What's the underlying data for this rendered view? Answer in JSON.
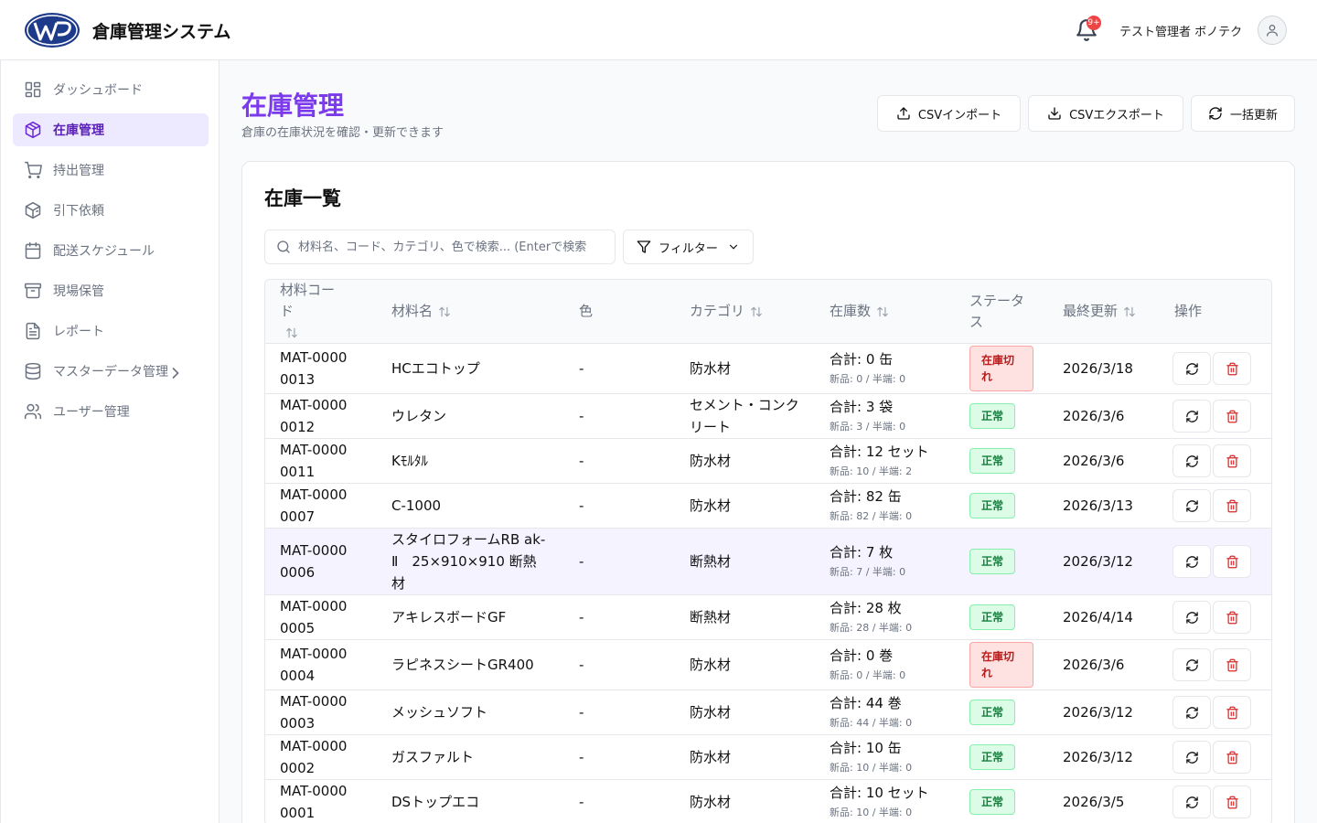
{
  "header": {
    "app_title": "倉庫管理システム",
    "notification_badge": "9+",
    "user_name": "テスト管理者 ボノテク"
  },
  "sidebar": {
    "items": [
      {
        "label": "ダッシュボード",
        "icon": "dashboard-icon"
      },
      {
        "label": "在庫管理",
        "icon": "box-icon",
        "active": true
      },
      {
        "label": "持出管理",
        "icon": "cart-icon"
      },
      {
        "label": "引下依頼",
        "icon": "package-icon"
      },
      {
        "label": "配送スケジュール",
        "icon": "calendar-icon"
      },
      {
        "label": "現場保管",
        "icon": "archive-icon"
      },
      {
        "label": "レポート",
        "icon": "document-icon"
      },
      {
        "label": "マスターデータ管理",
        "icon": "database-icon"
      },
      {
        "label": "ユーザー管理",
        "icon": "users-icon"
      }
    ]
  },
  "page": {
    "title": "在庫管理",
    "subtitle": "倉庫の在庫状況を確認・更新できます",
    "csv_import": "CSVインポート",
    "csv_export": "CSVエクスポート",
    "bulk_update": "一括更新"
  },
  "card": {
    "title": "在庫一覧",
    "search_placeholder": "材料名、コード、カテゴリ、色で検索... (Enterで検索",
    "filter_label": "フィルター"
  },
  "table": {
    "columns": [
      "材料コード",
      "材料名",
      "色",
      "カテゴリ",
      "在庫数",
      "ステータス",
      "最終更新",
      "操作"
    ],
    "rows": [
      {
        "code": "MAT-00000013",
        "name": "HCエコトップ",
        "color": "-",
        "category": "防水材",
        "total": "合計: 0 缶",
        "sub": "新品: 0 / 半端: 0",
        "status": "在庫切れ",
        "status_type": "out",
        "updated": "2026/3/18"
      },
      {
        "code": "MAT-00000012",
        "name": "ウレタン",
        "color": "-",
        "category": "セメント・コンクリート",
        "total": "合計: 3 袋",
        "sub": "新品: 3 / 半端: 0",
        "status": "正常",
        "status_type": "ok",
        "updated": "2026/3/6"
      },
      {
        "code": "MAT-00000011",
        "name": "Kﾓﾙﾀﾙ",
        "color": "-",
        "category": "防水材",
        "total": "合計: 12 セット",
        "sub": "新品: 10 / 半端: 2",
        "status": "正常",
        "status_type": "ok",
        "updated": "2026/3/6"
      },
      {
        "code": "MAT-00000007",
        "name": "C-1000",
        "color": "-",
        "category": "防水材",
        "total": "合計: 82 缶",
        "sub": "新品: 82 / 半端: 0",
        "status": "正常",
        "status_type": "ok",
        "updated": "2026/3/13"
      },
      {
        "code": "MAT-00000006",
        "name": "スタイロフォームRB ak-Ⅱ　25×910×910 断熱材",
        "color": "-",
        "category": "断熱材",
        "total": "合計: 7 枚",
        "sub": "新品: 7 / 半端: 0",
        "status": "正常",
        "status_type": "ok",
        "updated": "2026/3/12",
        "highlight": true
      },
      {
        "code": "MAT-00000005",
        "name": "アキレスボードGF",
        "color": "-",
        "category": "断熱材",
        "total": "合計: 28 枚",
        "sub": "新品: 28 / 半端: 0",
        "status": "正常",
        "status_type": "ok",
        "updated": "2026/4/14"
      },
      {
        "code": "MAT-00000004",
        "name": "ラピネスシートGR400",
        "color": "-",
        "category": "防水材",
        "total": "合計: 0 巻",
        "sub": "新品: 0 / 半端: 0",
        "status": "在庫切れ",
        "status_type": "out",
        "updated": "2026/3/6"
      },
      {
        "code": "MAT-00000003",
        "name": "メッシュソフト",
        "color": "-",
        "category": "防水材",
        "total": "合計: 44 巻",
        "sub": "新品: 44 / 半端: 0",
        "status": "正常",
        "status_type": "ok",
        "updated": "2026/3/12"
      },
      {
        "code": "MAT-00000002",
        "name": "ガスファルト",
        "color": "-",
        "category": "防水材",
        "total": "合計: 10 缶",
        "sub": "新品: 10 / 半端: 0",
        "status": "正常",
        "status_type": "ok",
        "updated": "2026/3/12"
      },
      {
        "code": "MAT-00000001",
        "name": "DSトップエコ",
        "color": "-",
        "category": "防水材",
        "total": "合計: 10 セット",
        "sub": "新品: 10 / 半端: 0",
        "status": "正常",
        "status_type": "ok",
        "updated": "2026/3/5"
      }
    ]
  },
  "colors": {
    "accent": "#7c3aed",
    "active_bg": "#ede9fe",
    "ok_bg": "#dcfce7",
    "ok_text": "#15803d",
    "out_bg": "#fee2e2",
    "out_text": "#b91c1c"
  }
}
